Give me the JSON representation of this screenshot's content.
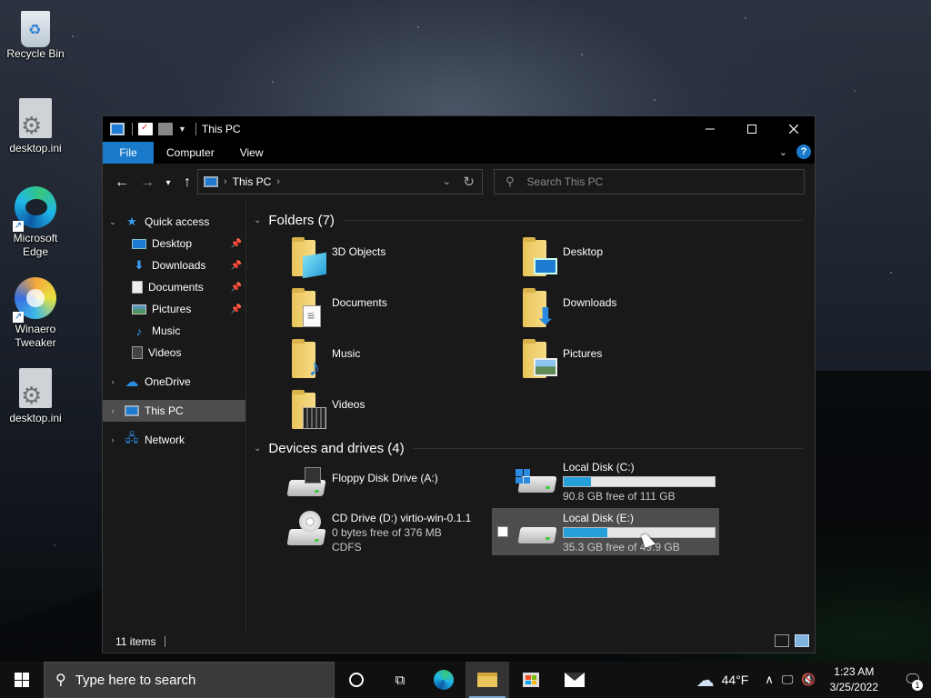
{
  "desktop": {
    "icons": [
      {
        "label": "Recycle Bin",
        "icon": "recycle-bin-icon"
      },
      {
        "label": "desktop.ini",
        "icon": "ini-file-icon"
      },
      {
        "label": "Microsoft Edge",
        "icon": "edge-icon"
      },
      {
        "label": "Winaero Tweaker",
        "icon": "winaero-icon"
      },
      {
        "label": "desktop.ini",
        "icon": "ini-file-icon"
      }
    ]
  },
  "window": {
    "title": "This PC",
    "ribbon": {
      "tabs": [
        "File",
        "Computer",
        "View"
      ]
    },
    "address": {
      "crumb": "This PC"
    },
    "search": {
      "placeholder": "Search This PC"
    },
    "nav_pane": {
      "quick_access": "Quick access",
      "pinned": [
        "Desktop",
        "Downloads",
        "Documents",
        "Pictures"
      ],
      "unpinned": [
        "Music",
        "Videos"
      ],
      "onedrive": "OneDrive",
      "this_pc": "This PC",
      "network": "Network"
    },
    "folders": {
      "header": "Folders (7)",
      "items": [
        "3D Objects",
        "Desktop",
        "Documents",
        "Downloads",
        "Music",
        "Pictures",
        "Videos"
      ]
    },
    "devices": {
      "header": "Devices and drives (4)",
      "floppy": {
        "name": "Floppy Disk Drive (A:)"
      },
      "c_drive": {
        "name": "Local Disk (C:)",
        "free": "90.8 GB free of 111 GB",
        "used_fraction": 0.18
      },
      "cd_drive": {
        "name": "CD Drive (D:) virtio-win-0.1.1",
        "free": "0 bytes free of 376 MB",
        "fs": "CDFS"
      },
      "e_drive": {
        "name": "Local Disk (E:)",
        "free": "35.3 GB free of 49.9 GB",
        "used_fraction": 0.29
      }
    },
    "status": {
      "items": "11 items"
    }
  },
  "taskbar": {
    "search_placeholder": "Type here to search",
    "weather": "44°F",
    "time": "1:23 AM",
    "date": "3/25/2022",
    "notifications": "1"
  },
  "colors": {
    "accent": "#1979ca",
    "selection": "#4d4d4d",
    "drive_bar": "#26a0da"
  }
}
